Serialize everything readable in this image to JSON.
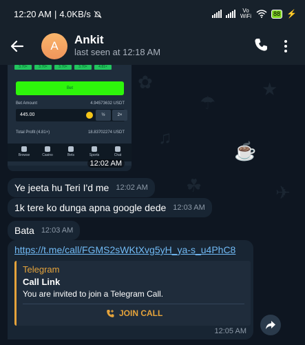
{
  "status": {
    "time": "12:20 AM",
    "speed": "4.0KB/s",
    "network": "Vo WiFi",
    "battery": "88"
  },
  "header": {
    "avatar_letter": "A",
    "name": "Ankit",
    "status": "last seen at 12:18 AM"
  },
  "image_message": {
    "time": "12:02 AM",
    "screenshot": {
      "multipliers": [
        "3.70×",
        "3.70×",
        "3.70×",
        "3.70×",
        "4.81×"
      ],
      "bet_button": "Bet",
      "bet_amount_label": "Bet Amount",
      "bet_amount_usdt": "4.94573632 USDT",
      "bet_amount_value": "445.00",
      "half_label": "½",
      "double_label": "2×",
      "total_profit_label": "Total Profit (4.81×)",
      "total_profit_usdt": "18.83702274 USDT",
      "tabs": [
        "Browse",
        "Casino",
        "Bets",
        "Sports",
        "Chat"
      ]
    }
  },
  "messages": [
    {
      "text": "Ye jeeta hu Teri I'd me",
      "time": "12:02 AM"
    },
    {
      "text": "1k tere ko dunga apna google dede",
      "time": "12:03 AM"
    },
    {
      "text": "Bata",
      "time": "12:03 AM"
    }
  ],
  "link_message": {
    "url": "https://t.me/call/FGMS2sWKtXvg5yH_ya-s_u4PhC8",
    "site": "Telegram",
    "title": "Call Link",
    "description": "You are invited to join a Telegram Call.",
    "action": "JOIN CALL",
    "time": "12:05 AM"
  }
}
